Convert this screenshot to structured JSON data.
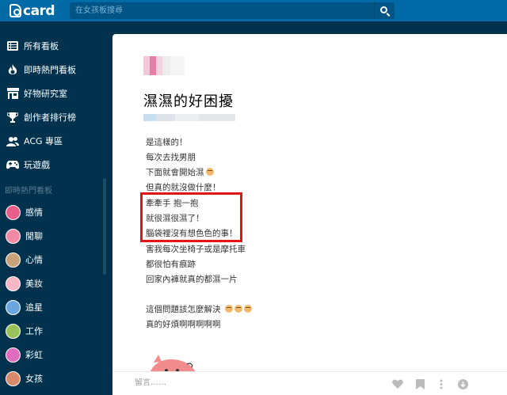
{
  "header": {
    "logo_text": "card",
    "search_placeholder": "在女孩板搜尋"
  },
  "sidebar": {
    "nav_items": [
      {
        "label": "所有看板",
        "icon": "list-icon"
      },
      {
        "label": "即時熱門看板",
        "icon": "flame-icon"
      },
      {
        "label": "好物研究室",
        "icon": "shop-icon"
      },
      {
        "label": "創作者排行榜",
        "icon": "trophy-icon"
      },
      {
        "label": "ACG 專區",
        "icon": "users-icon"
      },
      {
        "label": "玩遊戲",
        "icon": "gamepad-icon"
      }
    ],
    "section_title": "即時熱門看板",
    "boards": [
      {
        "label": "感情",
        "color": "#e85d8a"
      },
      {
        "label": "閒聊",
        "color": "#f28aa5"
      },
      {
        "label": "心情",
        "color": "#c9a27a"
      },
      {
        "label": "美妝",
        "color": "#f5b7c4"
      },
      {
        "label": "追星",
        "color": "#6aa7e0"
      },
      {
        "label": "工作",
        "color": "#9ac25a"
      },
      {
        "label": "彩虹",
        "color": "#e06cc0"
      },
      {
        "label": "女孩",
        "color": "#d98a6a"
      }
    ]
  },
  "post": {
    "title": "濕濕的好困擾",
    "lines": [
      "是這樣的！",
      "每次去找男朋",
      "下面就會開始濕",
      "但真的就沒做什麼！",
      "牽牽手 抱一抱",
      "就很濕很濕了！",
      "腦袋裡沒有想色色的事！",
      "害我每次坐椅子或是摩托車",
      "都很怕有痕跡",
      "回家內褲就真的都濕一片",
      "",
      "這個問題該怎麼解決",
      "真的好煩啊啊啊啊啊"
    ],
    "comment_placeholder": "留言……"
  },
  "colors": {
    "topbar": "#006aa6",
    "sidebar": "#00324e",
    "highlight_border": "#e21515"
  }
}
